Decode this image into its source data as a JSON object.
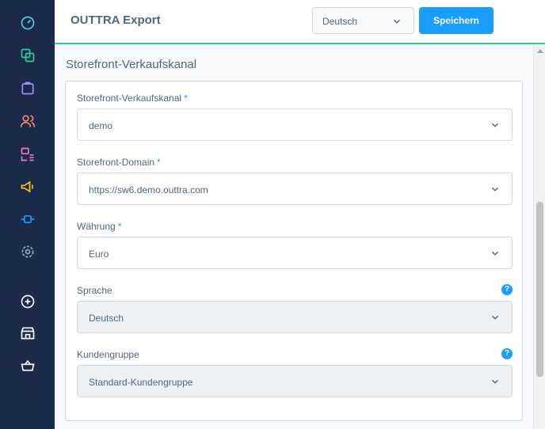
{
  "header": {
    "title": "OUTTRA Export",
    "language_value": "Deutsch",
    "save_label": "Speichern"
  },
  "section": {
    "title": "Storefront-Verkaufskanal"
  },
  "fields": [
    {
      "label": "Storefront-Verkaufskanal",
      "required": "*",
      "value": "demo"
    },
    {
      "label": "Storefront-Domain",
      "required": "*",
      "value": "https://sw6.demo.outtra.com"
    },
    {
      "label": "Währung",
      "required": "*",
      "value": "Euro"
    },
    {
      "label": "Sprache",
      "help": "?",
      "value": "Deutsch"
    },
    {
      "label": "Kundengruppe",
      "help": "?",
      "value": "Standard-Kundengruppe"
    }
  ],
  "sidebar": {
    "icons": [
      "dashboard-icon",
      "catalog-icon",
      "orders-icon",
      "customers-icon",
      "content-icon",
      "marketing-icon",
      "extensions-icon",
      "settings-icon",
      "add-icon",
      "store-icon",
      "basket-icon"
    ]
  },
  "colors": {
    "sidebar_bg": "#1b2a48",
    "accent": "#189eff",
    "header_border": "#2ecc9f",
    "text": "#52667a"
  }
}
